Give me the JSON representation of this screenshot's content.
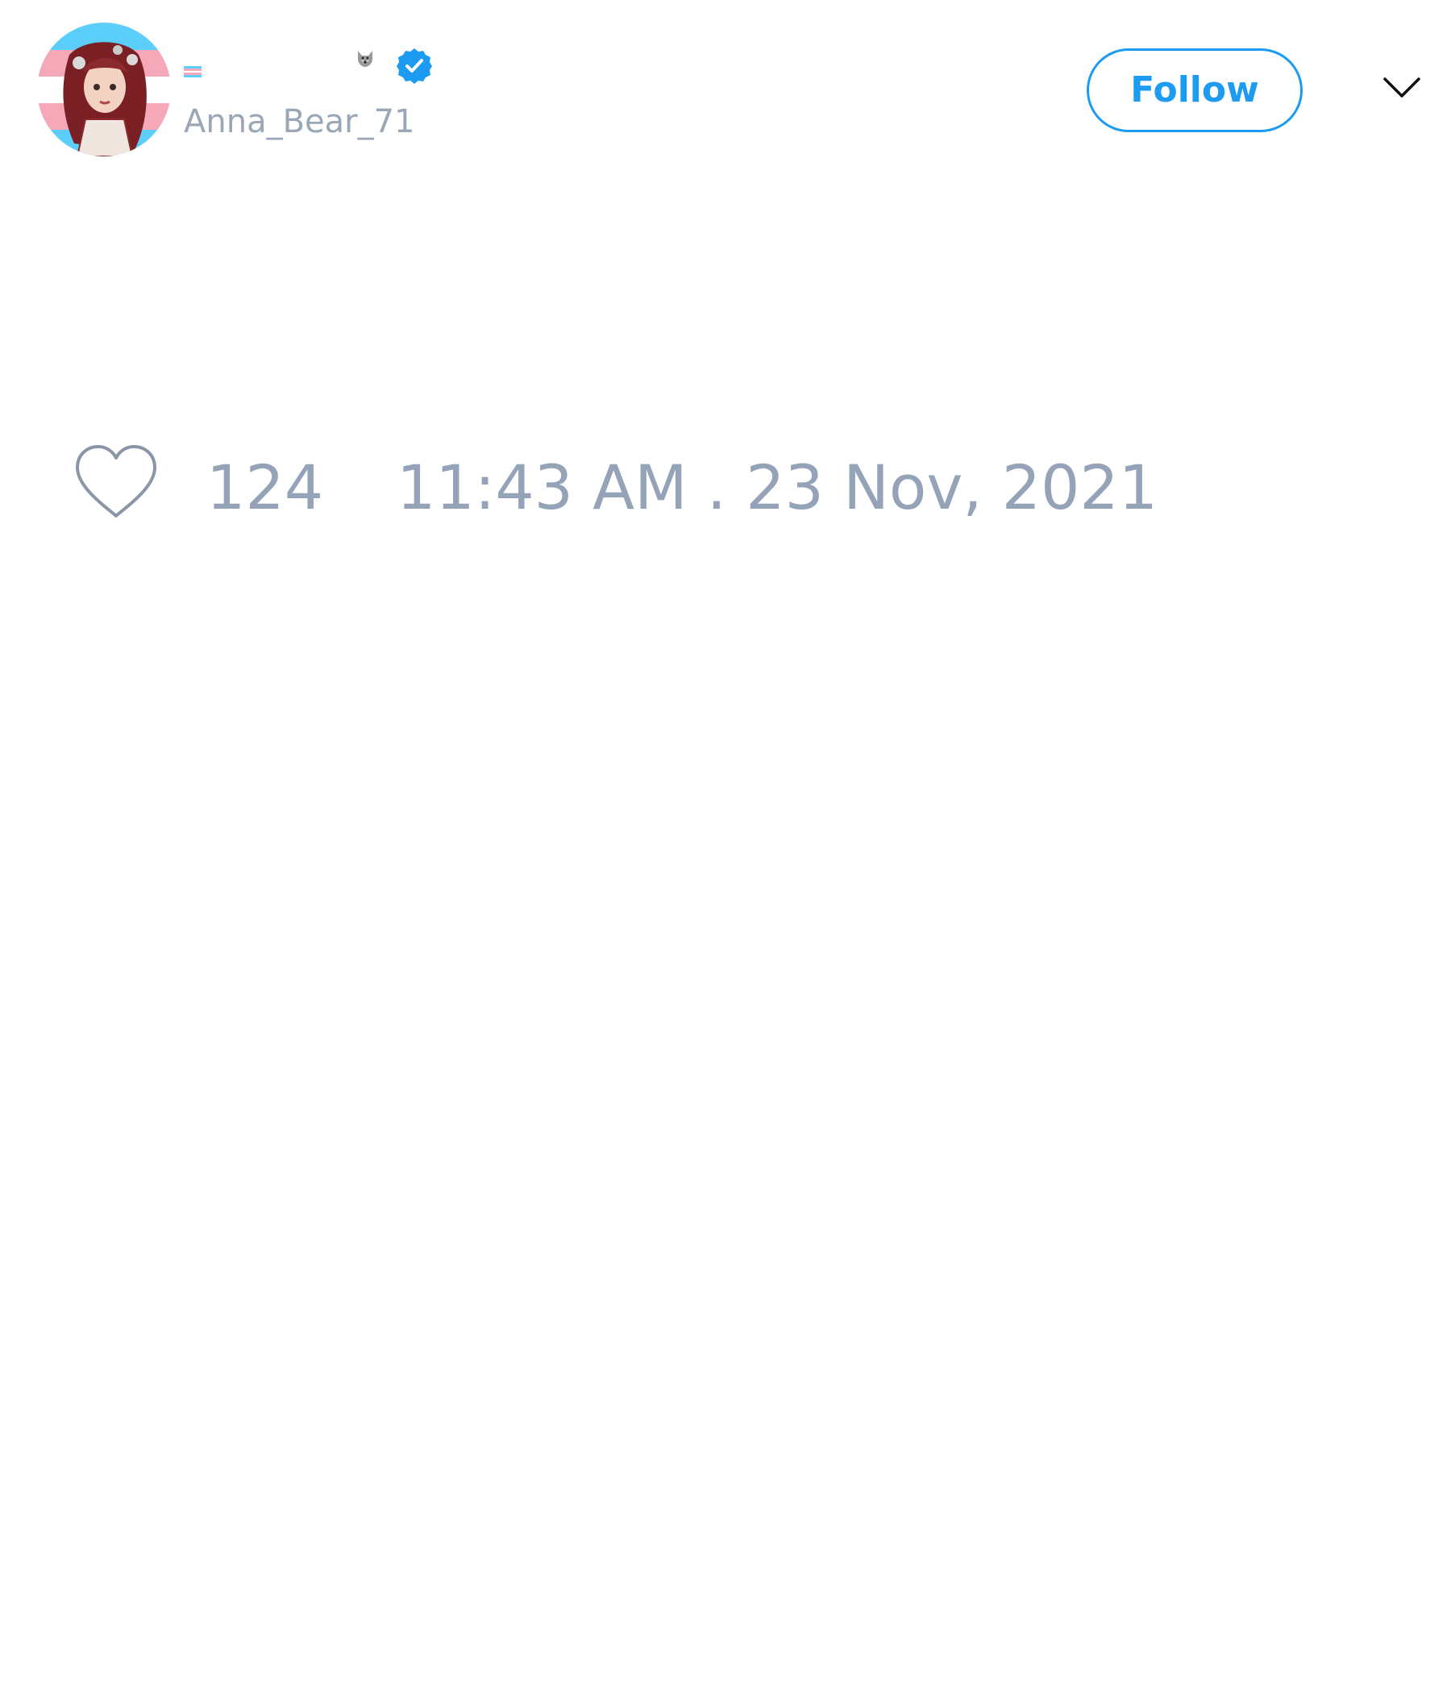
{
  "author": {
    "display_name": "",
    "handle": "Anna_Bear_71",
    "avatar_icon": "avatar-illustration",
    "flag_icon": "transgender-flag-icon",
    "emoji_icon": "wolf-icon",
    "verified_icon": "verified-badge-icon"
  },
  "actions": {
    "follow_label": "Follow",
    "menu_icon": "chevron-down-icon"
  },
  "stats": {
    "like_icon": "heart-icon",
    "likes": "124",
    "timestamp": "11:43 AM . 23 Nov, 2021"
  },
  "colors": {
    "accent": "#1d9bf0",
    "muted_text": "#94a3b8",
    "handle_text": "#9aa7b6",
    "background": "#ffffff"
  }
}
